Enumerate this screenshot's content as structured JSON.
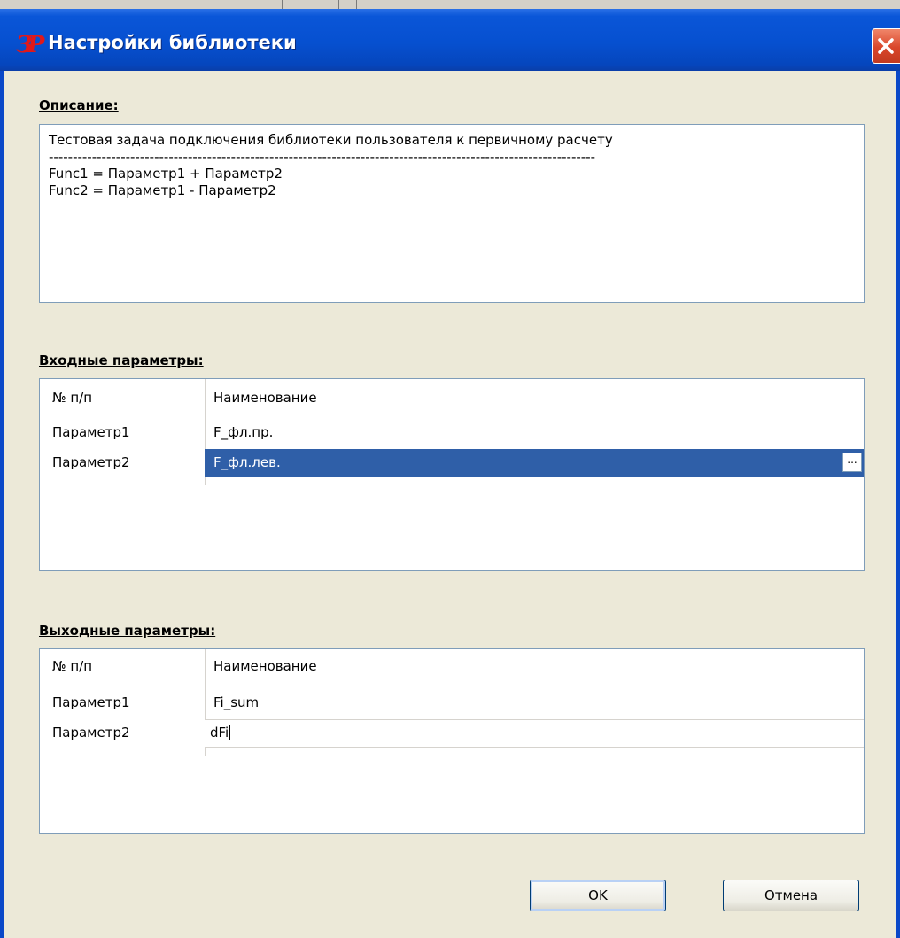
{
  "window": {
    "title": "Настройки библиотеки",
    "app_icon_glyph": "ЗР"
  },
  "description": {
    "label": "Описание:",
    "lines": [
      "Тестовая задача подключения библиотеки пользователя к первичному расчету",
      "------------------------------------------------------------------------------------------------------------------",
      "Func1 = Параметр1 + Параметр2",
      "Func2 = Параметр1 - Параметр2"
    ]
  },
  "inputs": {
    "label": "Входные параметры:",
    "header": {
      "num": "№ п/п",
      "name": "Наименование"
    },
    "rows": [
      {
        "num": "Параметр1",
        "name": "F_фл.пр."
      },
      {
        "num": "Параметр2",
        "name": "F_фл.лев.",
        "selected": true
      }
    ],
    "ellipsis": "..."
  },
  "outputs": {
    "label": "Выходные параметры:",
    "header": {
      "num": "№ п/п",
      "name": "Наименование"
    },
    "rows": [
      {
        "num": "Параметр1",
        "name": "Fi_sum"
      },
      {
        "num": "Параметр2",
        "name": "dFi",
        "editing": true
      }
    ]
  },
  "buttons": {
    "ok": "OK",
    "cancel": "Отмена"
  },
  "colors": {
    "titlebar": "#0650d0",
    "selection": "#2f5fa8",
    "dialog_bg": "#ece9d8"
  }
}
